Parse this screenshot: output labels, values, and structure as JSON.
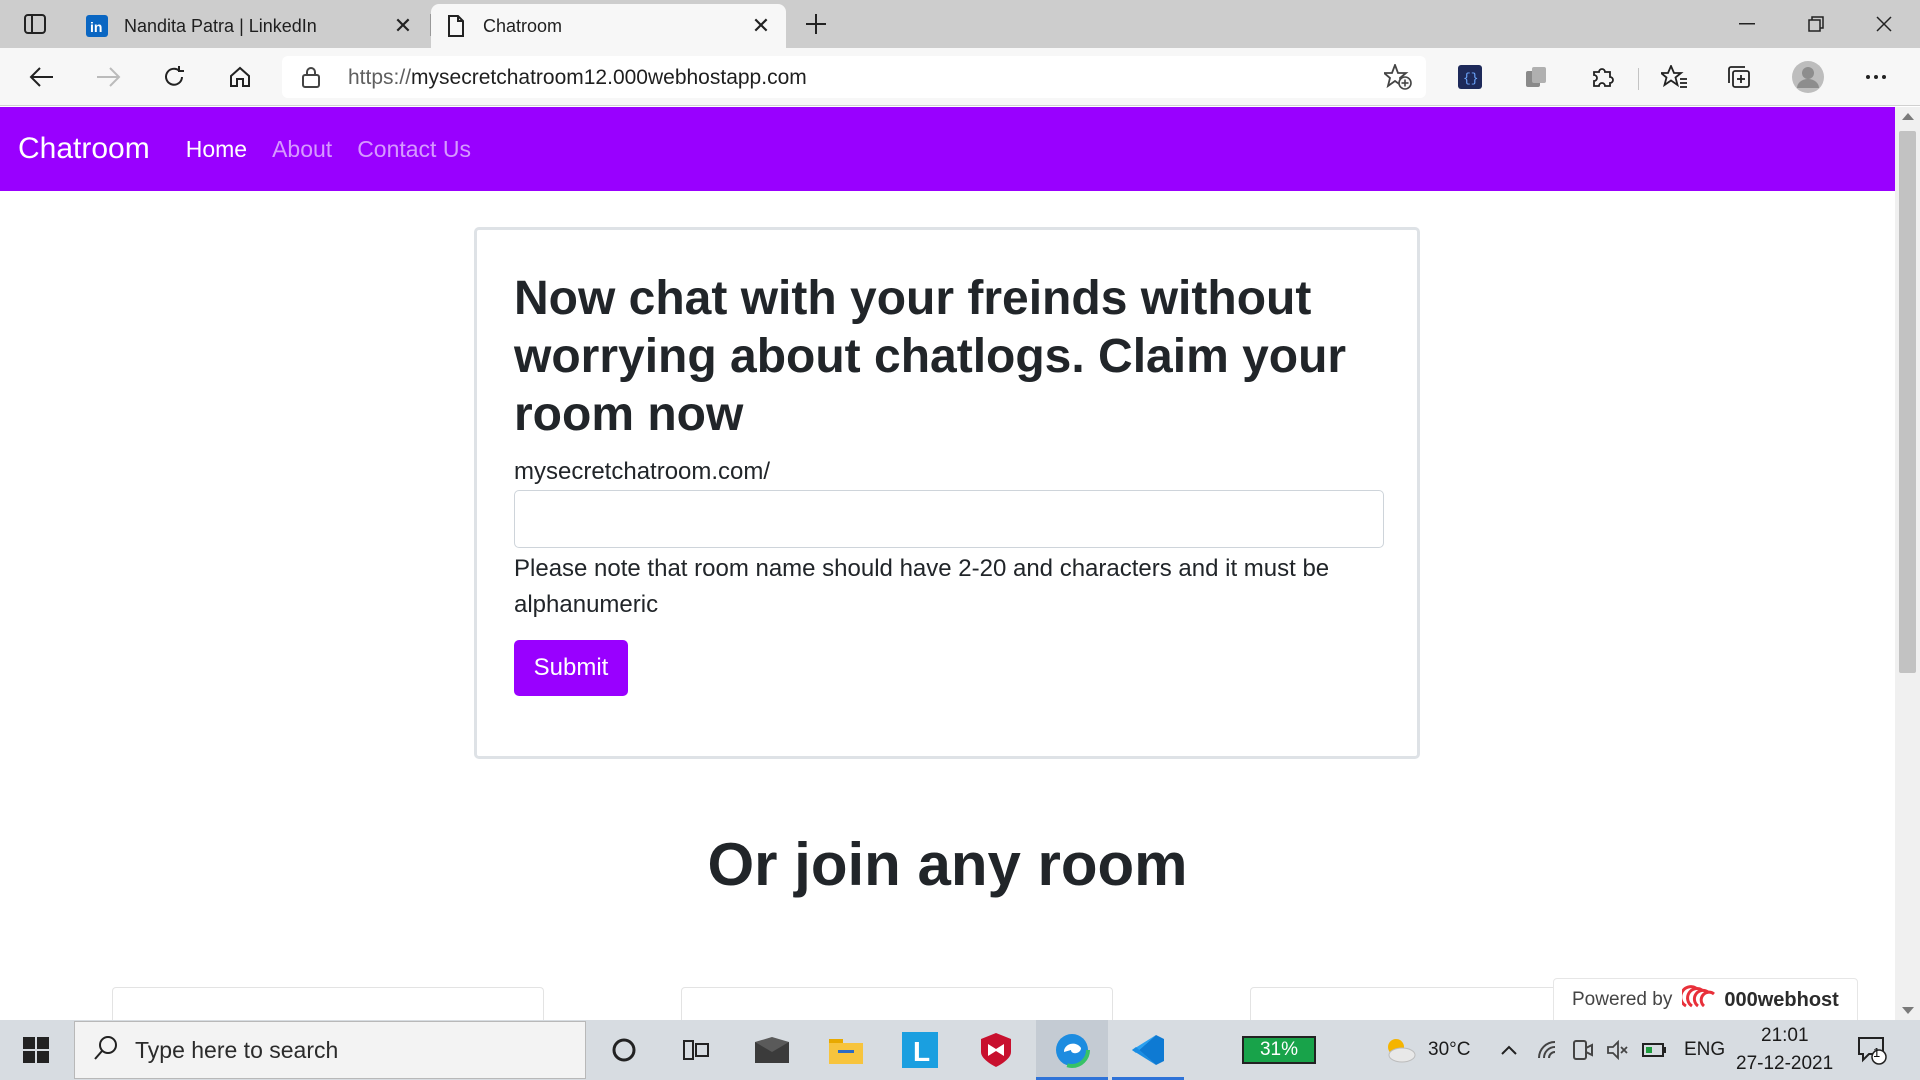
{
  "browser": {
    "tabs": [
      {
        "title": "Nandita Patra | LinkedIn",
        "favicon": "linkedin-icon",
        "active": false
      },
      {
        "title": "Chatroom",
        "favicon": "page-icon",
        "active": true
      }
    ],
    "address": {
      "protocol": "https://",
      "host": "mysecretchatroom12.000webhostapp.com"
    }
  },
  "navbar": {
    "brand": "Chatroom",
    "links": [
      "Home",
      "About",
      "Contact Us"
    ],
    "active_link": "Home",
    "color": "#9900ff"
  },
  "claim": {
    "heading": "Now chat with your freinds without worrying about chatlogs. Claim your room now",
    "prefix": "mysecretchatroom.com/",
    "input_value": "",
    "note": "Please note that room name should have 2-20 and characters and it must be alphanumeric",
    "submit_label": "Submit"
  },
  "join": {
    "heading": "Or join any room"
  },
  "powered_by": {
    "label": "Powered by",
    "brand": "000webhost"
  },
  "taskbar": {
    "search_placeholder": "Type here to search",
    "battery_widget": "31%",
    "weather": "30°C",
    "language": "ENG",
    "time": "21:01",
    "date": "27-12-2021",
    "notifications": "1"
  }
}
